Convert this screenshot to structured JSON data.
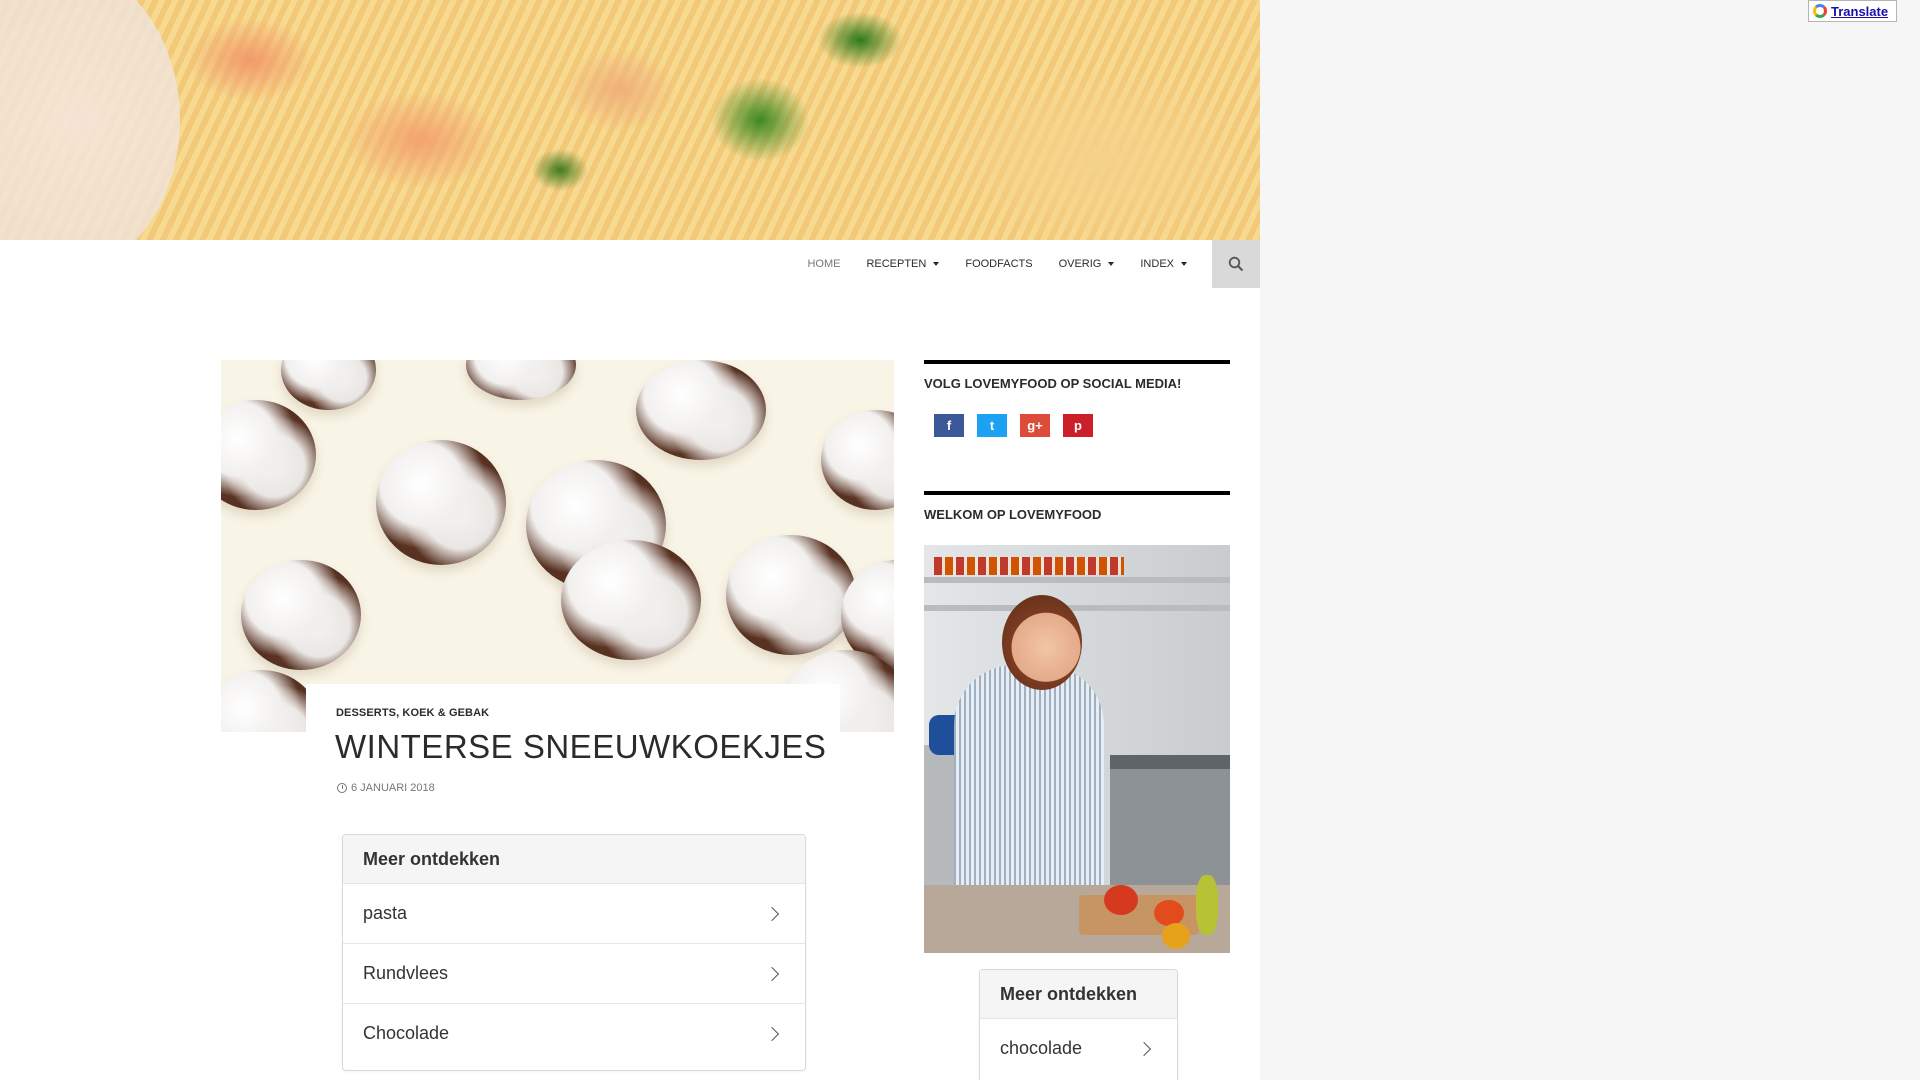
{
  "header": {
    "nav": [
      {
        "label": "Home",
        "has_dropdown": false,
        "active": true
      },
      {
        "label": "Recepten",
        "has_dropdown": true,
        "active": false
      },
      {
        "label": "Foodfacts",
        "has_dropdown": false,
        "active": false
      },
      {
        "label": "Overig",
        "has_dropdown": true,
        "active": false
      },
      {
        "label": "Index",
        "has_dropdown": true,
        "active": false
      }
    ],
    "search_icon": "search-icon"
  },
  "post": {
    "categories": "Desserts, Koek & Gebak",
    "title": "Winterse sneeuwkoekjes",
    "date": "6 januari 2018",
    "date_icon": "clock-icon"
  },
  "discover_main": {
    "title": "Meer ontdekken",
    "items": [
      "pasta",
      "Rundvlees",
      "Chocolade"
    ]
  },
  "sidebar": {
    "social_title": "Volg LOVEMYFOOD op Social Media!",
    "social": [
      {
        "label": "f",
        "icon": "facebook-icon",
        "color": "#3b5998"
      },
      {
        "label": "t",
        "icon": "twitter-icon",
        "color": "#1da1f2"
      },
      {
        "label": "g+",
        "icon": "google-plus-icon",
        "color": "#dd4b39"
      },
      {
        "label": "p",
        "icon": "pinterest-icon",
        "color": "#cb2027"
      }
    ],
    "welcome_title": "Welkom op LOVEMYFOOD",
    "discover": {
      "title": "Meer ontdekken",
      "items": [
        "chocolade"
      ]
    }
  },
  "translate": {
    "label": "Translate",
    "icon": "google-g-icon"
  },
  "colors": {
    "accent_bar": "#000000",
    "nav_search_bg": "#d9d9d9",
    "page_bg": "#f6f6f6"
  }
}
